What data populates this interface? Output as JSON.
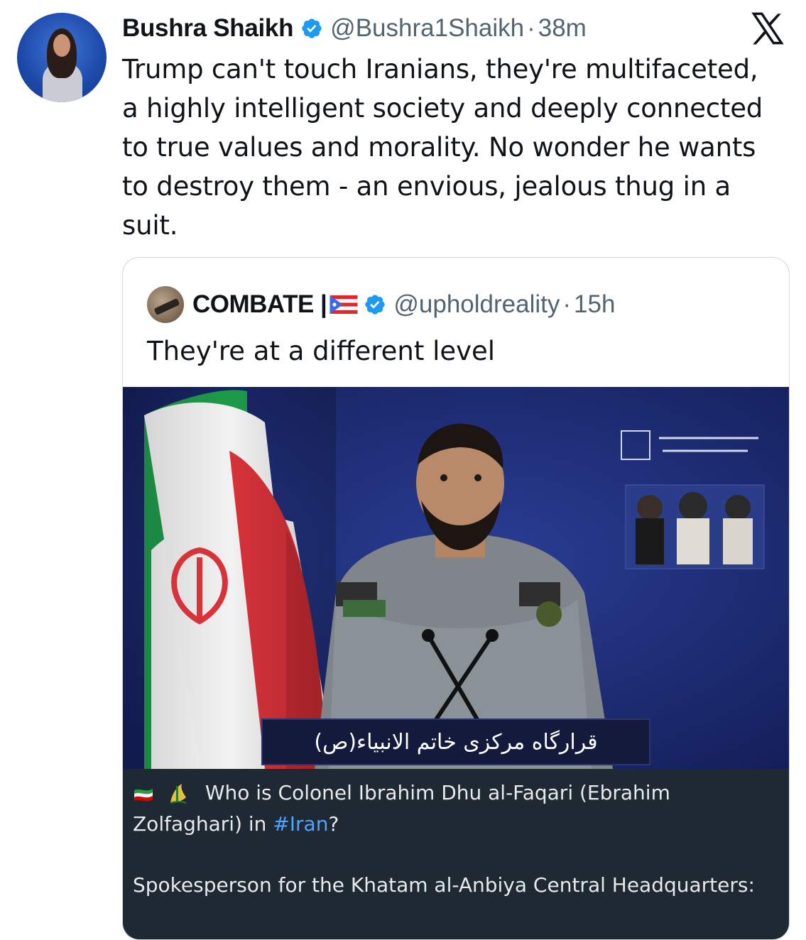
{
  "tweet": {
    "author_name": "Bushra Shaikh",
    "author_handle": "@Bushra1Shaikh",
    "separator": "·",
    "time": "38m",
    "text_lines": [
      "Trump can't touch Iranians, they're multifaceted,",
      "a highly intelligent society and deeply connected",
      "to true values and morality. No wonder he wants",
      "to destroy them -  an envious, jealous thug in a",
      "suit."
    ]
  },
  "quote": {
    "author_name": "COMBATE |",
    "author_handle": "@upholdreality",
    "separator": "·",
    "time": "15h",
    "text": "They're at a different level",
    "media": {
      "podium_text": "قرارگاه مرکزی خاتم الانبیاء(ص)"
    },
    "caption": {
      "line1": "Who is Colonel Ibrahim Dhu al-Faqari (Ebrahim",
      "line2_prefix": "Zolfaghari) in ",
      "hashtag": "#Iran",
      "line2_suffix": "?",
      "line3": "Spokesperson for the Khatam al-Anbiya Central Headquarters:"
    }
  },
  "icons": {
    "verified": "verified-badge-icon",
    "x_logo": "x-logo-icon",
    "flag_puerto_rico": "puerto-rico-flag-icon",
    "flag_iran": "iran-flag-icon",
    "irgc_emblem": "irgc-emblem-icon"
  },
  "colors": {
    "text_primary": "#0f1419",
    "text_secondary": "#536471",
    "verified_blue": "#1d9bf0",
    "border": "#cfd9de",
    "caption_bg": "#1f2933",
    "hashtag": "#4da3ff",
    "media_bg": "#1c2b73"
  }
}
